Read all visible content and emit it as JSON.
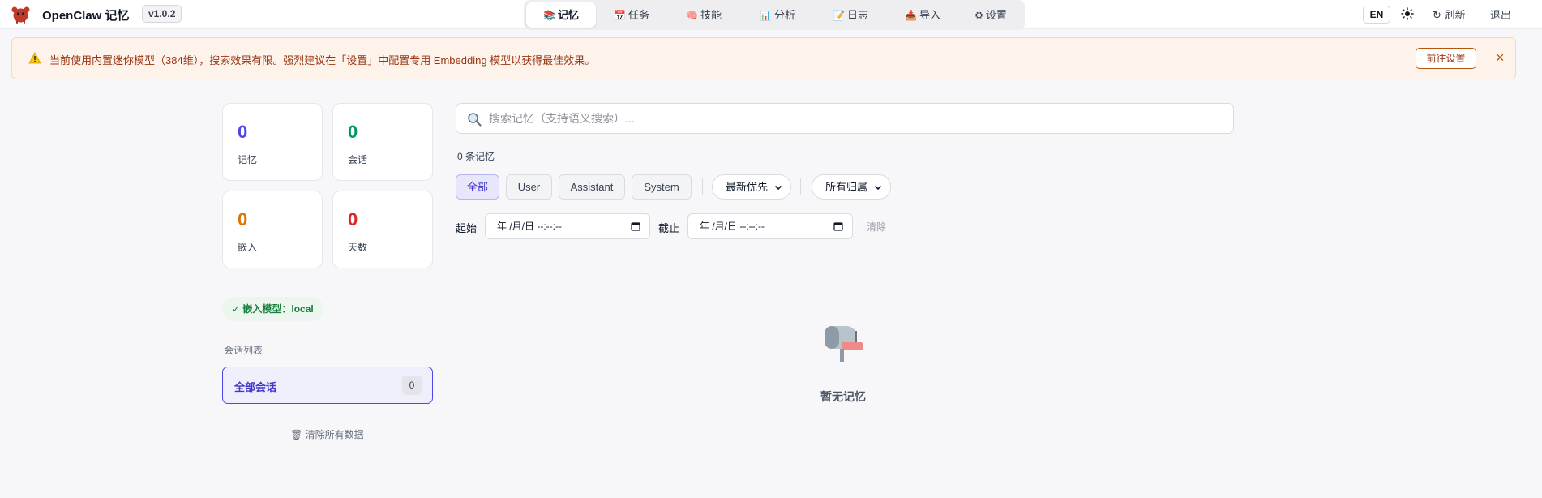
{
  "app": {
    "title": "OpenClaw 记忆",
    "version": "v1.0.2",
    "brand_color": "#c0392b"
  },
  "nav": {
    "tabs": [
      {
        "icon": "books-icon",
        "glyph": "📚",
        "label": "记忆",
        "active": true
      },
      {
        "icon": "notepad-icon",
        "glyph": "📅",
        "label": "任务",
        "active": false
      },
      {
        "icon": "brain-icon",
        "glyph": "🧠",
        "label": "技能",
        "active": false
      },
      {
        "icon": "bar-chart-icon",
        "glyph": "📊",
        "label": "分析",
        "active": false
      },
      {
        "icon": "memo-icon",
        "glyph": "📝",
        "label": "日志",
        "active": false
      },
      {
        "icon": "inbox-tray-icon",
        "glyph": "📥",
        "label": "导入",
        "active": false
      },
      {
        "icon": "gear-icon",
        "glyph": "⚙",
        "label": "设置",
        "active": false
      }
    ]
  },
  "header_actions": {
    "lang": "EN",
    "theme_icon": "sun-icon",
    "refresh_glyph": "↻",
    "refresh_label": "刷新",
    "logout_label": "退出"
  },
  "banner": {
    "icon": "warning-icon",
    "text": "当前使用内置迷你模型（384维），搜索效果有限。强烈建议在「设置」中配置专用 Embedding 模型以获得最佳效果。",
    "action_label": "前往设置",
    "close_glyph": "×",
    "accent_color": "#9a3412"
  },
  "stats": {
    "memories": {
      "value": "0",
      "label": "记忆",
      "color": "#4f46e5"
    },
    "sessions": {
      "value": "0",
      "label": "会话",
      "color": "#059669"
    },
    "embeddings": {
      "value": "0",
      "label": "嵌入",
      "color": "#d97706"
    },
    "days": {
      "value": "0",
      "label": "天数",
      "color": "#dc2626"
    }
  },
  "sidebar": {
    "model_status": "✓ 嵌入模型：local",
    "section_label": "会话列表",
    "sessions": [
      {
        "label": "全部会话",
        "count": "0",
        "selected": true
      }
    ],
    "clear_all_glyph": "🗑",
    "clear_all_label": "清除所有数据"
  },
  "search": {
    "placeholder": "搜索记忆（支持语义搜索）...",
    "value": ""
  },
  "results": {
    "count_text": "0 条记忆"
  },
  "filters": {
    "roles": [
      {
        "label": "全部",
        "active": true
      },
      {
        "label": "User",
        "active": false
      },
      {
        "label": "Assistant",
        "active": false
      },
      {
        "label": "System",
        "active": false
      }
    ],
    "sort_value": "最新优先",
    "owner_value": "所有归属"
  },
  "date_range": {
    "start_label": "起始",
    "start_value": "年 /月/日 --:--:--",
    "end_label": "截止",
    "end_value": "年 /月/日 --:--:--",
    "clear_label": "清除"
  },
  "empty_state": {
    "icon": "mailbox-icon",
    "text": "暂无记忆"
  }
}
